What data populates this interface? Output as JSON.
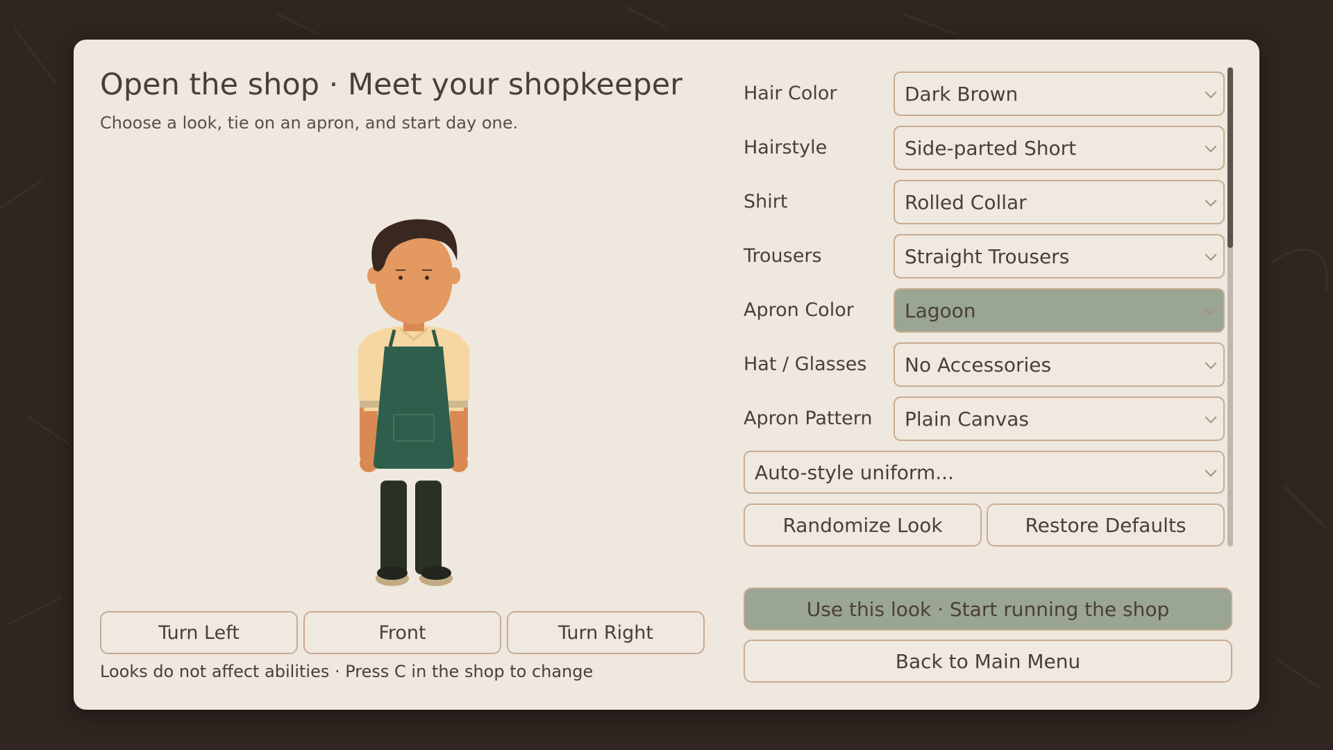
{
  "colors": {
    "backdrop": "#2f2621",
    "panel": "#eee8de",
    "accent_green": "#9aa593",
    "border": "#c9ab90",
    "text": "#4a3f38"
  },
  "header": {
    "title": "Open the shop · Meet your shopkeeper",
    "subtitle": "Choose a look, tie on an apron, and start day one."
  },
  "preview": {
    "rotate_buttons": {
      "left": "Turn Left",
      "front": "Front",
      "right": "Turn Right"
    },
    "hint": "Looks do not affect abilities · Press C in the shop to change"
  },
  "options": [
    {
      "label": "Hair Color",
      "value": "Dark Brown"
    },
    {
      "label": "Hairstyle",
      "value": "Side-parted Short"
    },
    {
      "label": "Shirt",
      "value": "Rolled Collar"
    },
    {
      "label": "Trousers",
      "value": "Straight Trousers"
    },
    {
      "label": "Apron Color",
      "value": "Lagoon"
    },
    {
      "label": "Hat / Glasses",
      "value": "No Accessories"
    },
    {
      "label": "Apron Pattern",
      "value": "Plain Canvas"
    }
  ],
  "active_option": "Apron Color",
  "auto_style": "Auto-style uniform...",
  "actions": {
    "randomize": "Randomize Look",
    "restore": "Restore Defaults",
    "confirm": "Use this look · Start running the shop",
    "back": "Back to Main Menu"
  },
  "scrollbar": {
    "position": 0
  }
}
